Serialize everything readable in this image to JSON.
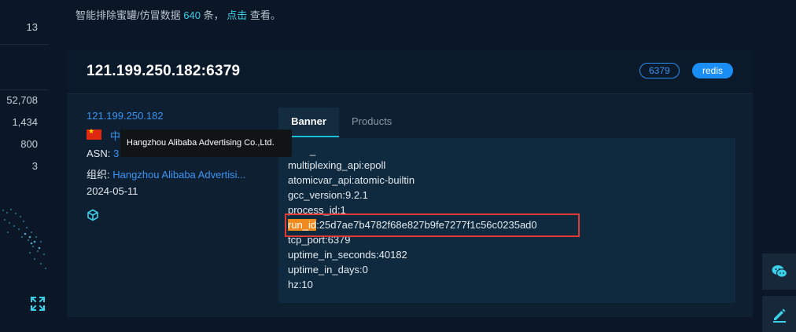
{
  "sidebar_stats": [
    "13",
    "52,708",
    "1,434",
    "800",
    "3"
  ],
  "notice": {
    "prefix": "智能排除蜜罐/仿冒数据",
    "count": "640",
    "middle": "条，",
    "link": "点击",
    "suffix": "查看。"
  },
  "card": {
    "title": "121.199.250.182:6379",
    "port_tag": "6379",
    "service_tag": "redis",
    "ip": "121.199.250.182",
    "country": "中",
    "asn_label": "ASN:",
    "asn_value": "3",
    "org_label": "组织:",
    "org_value": "Hangzhou Alibaba Advertisi...",
    "date": "2024-05-11",
    "tooltip": "Hangzhou Alibaba Advertising Co.,Ltd."
  },
  "tabs": [
    "Banner",
    "Products"
  ],
  "banner": {
    "lines": [
      "_",
      "multiplexing_api:epoll",
      "atomicvar_api:atomic-builtin",
      "gcc_version:9.2.1",
      "process_id:1",
      "tcp_port:6379",
      "uptime_in_seconds:40182",
      "uptime_in_days:0",
      "hz:10"
    ],
    "highlight_key": "run_id",
    "highlight_value": ":25d7ae7b4782f68e827b9fe7277f1c56c0235ad0"
  },
  "icons": [
    "china-flag-icon",
    "cube-icon",
    "expand-icon",
    "wechat-icon",
    "edit-icon"
  ],
  "colors": {
    "background": "#0b1726",
    "card": "#0e1f31",
    "link": "#3b95f3",
    "accent": "#18c4dc",
    "highlight": "#f08a1c",
    "red_box": "#e23b36"
  }
}
